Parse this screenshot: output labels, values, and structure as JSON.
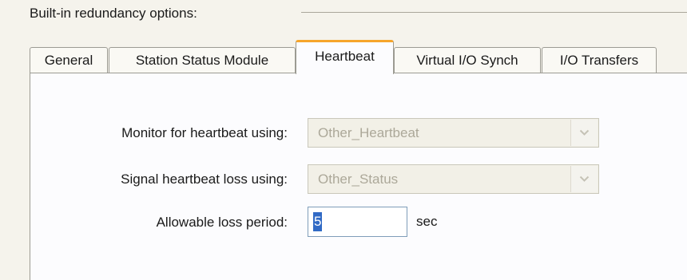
{
  "group": {
    "label": "Built-in redundancy options:"
  },
  "tabs": [
    {
      "label": "General",
      "active": false
    },
    {
      "label": "Station Status Module",
      "active": false
    },
    {
      "label": "Heartbeat",
      "active": true
    },
    {
      "label": "Virtual I/O Synch",
      "active": false
    },
    {
      "label": "I/O Transfers",
      "active": false
    }
  ],
  "heartbeat": {
    "monitor": {
      "label": "Monitor for heartbeat using:",
      "value": "Other_Heartbeat",
      "enabled": false
    },
    "signal": {
      "label": "Signal heartbeat loss using:",
      "value": "Other_Status",
      "enabled": false
    },
    "loss_period": {
      "label": "Allowable loss period:",
      "value": "5",
      "unit": "sec"
    }
  },
  "colors": {
    "active_tab_accent": "#f6a52b",
    "selection": "#316ac5",
    "disabled_text": "#aca899"
  },
  "icons": {
    "dropdown": "chevron-down-icon"
  }
}
